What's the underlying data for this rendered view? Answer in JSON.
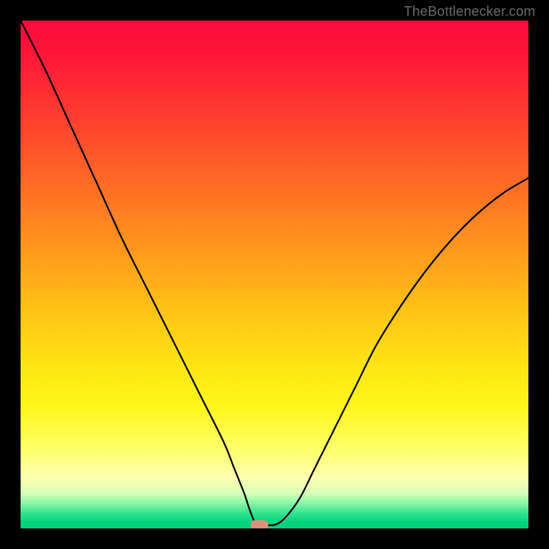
{
  "watermark": "TheBottlenecker.com",
  "chart_data": {
    "type": "line",
    "title": "",
    "xlabel": "",
    "ylabel": "",
    "xlim": [
      0,
      100
    ],
    "ylim": [
      0,
      100
    ],
    "x": [
      0,
      5,
      10,
      15,
      20,
      25,
      30,
      35,
      40,
      42,
      44,
      45,
      46,
      47,
      48,
      50,
      52,
      55,
      58,
      62,
      66,
      70,
      75,
      80,
      85,
      90,
      95,
      100
    ],
    "values": [
      100,
      90,
      79,
      68,
      57,
      47,
      37,
      27,
      17,
      12,
      7,
      4,
      1.5,
      0.7,
      0.7,
      0.7,
      2,
      6,
      12,
      20,
      28,
      36,
      44,
      51,
      57,
      62,
      66,
      69
    ],
    "min_point": {
      "x": 47,
      "y": 0.7
    },
    "annotations": [
      {
        "type": "marker",
        "x": 47,
        "y": 0.7,
        "color": "#dc8f7c"
      }
    ],
    "background_gradient": {
      "top": "#ff0b3e",
      "mid": "#ffe413",
      "bottom": "#04cf79"
    }
  }
}
